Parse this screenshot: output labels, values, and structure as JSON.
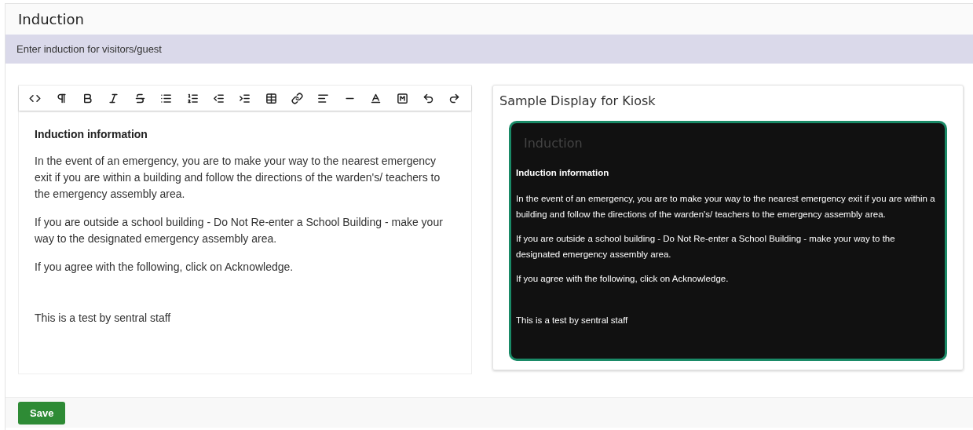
{
  "page": {
    "title": "Induction",
    "subtitle": "Enter induction for visitors/guest"
  },
  "editor": {
    "toolbar": [
      {
        "kind": "code"
      },
      {
        "kind": "paragraph"
      },
      {
        "kind": "bold"
      },
      {
        "kind": "italic"
      },
      {
        "kind": "strike"
      },
      {
        "kind": "bullets"
      },
      {
        "kind": "numbers"
      },
      {
        "kind": "outdent"
      },
      {
        "kind": "indent"
      },
      {
        "kind": "table"
      },
      {
        "kind": "link"
      },
      {
        "kind": "align"
      },
      {
        "kind": "rule"
      },
      {
        "kind": "textcolor"
      },
      {
        "kind": "bgcolor"
      },
      {
        "kind": "undo"
      },
      {
        "kind": "redo"
      }
    ],
    "content": [
      {
        "kind": "heading",
        "text": "Induction information"
      },
      {
        "kind": "paragraph",
        "text": "In the event of an emergency, you are to make your way to the nearest emergency exit if you are within a building and follow the directions of the warden's/ teachers to the emergency assembly area."
      },
      {
        "kind": "paragraph",
        "text": "If you are outside a school building - Do Not Re-enter a School Building - make your way to the designated emergency assembly area."
      },
      {
        "kind": "paragraph",
        "text": "If you agree with the following, click on Acknowledge."
      },
      {
        "kind": "note",
        "text": "This is a test by sentral staff"
      }
    ]
  },
  "kiosk": {
    "title": "Sample Display for Kiosk",
    "screen_title": "Induction",
    "content": [
      {
        "kind": "heading",
        "text": "Induction information"
      },
      {
        "kind": "paragraph",
        "text": "In the event of an emergency, you are to make your way to the nearest emergency exit if you are within a building and follow the directions of the warden's/ teachers to the emergency assembly area."
      },
      {
        "kind": "paragraph",
        "text": "If you are outside a school building - Do Not Re-enter a School Building - make your way to the designated emergency assembly area."
      },
      {
        "kind": "paragraph",
        "text": "If you agree with the following, click on Acknowledge."
      },
      {
        "kind": "note",
        "text": "This is a test by sentral staff"
      }
    ]
  },
  "footer": {
    "save_label": "Save"
  }
}
